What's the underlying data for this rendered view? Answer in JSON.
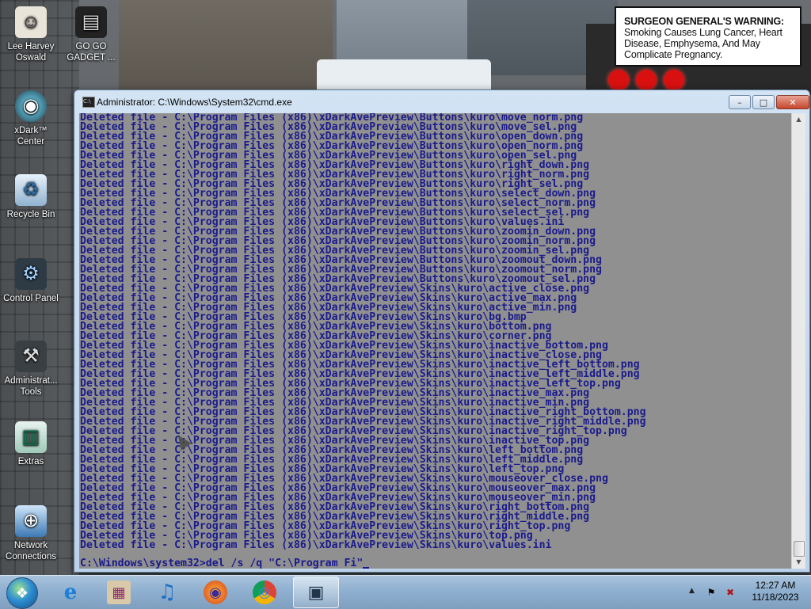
{
  "desktop": {
    "warning": {
      "heading": "SURGEON GENERAL'S WARNING:",
      "text": "Smoking Causes Lung Cancer, Heart Disease, Emphysema, And May Complicate Pregnancy."
    },
    "icons": [
      {
        "label": "Lee Harvey Oswald",
        "icon": "person-icon"
      },
      {
        "label": "GO GO GADGET ...",
        "icon": "gadget-icon"
      },
      {
        "label": "xDark™ Center",
        "icon": "xdark-center-icon"
      },
      {
        "label": "Recycle Bin",
        "icon": "recycle-bin-icon"
      },
      {
        "label": "Control Panel",
        "icon": "control-panel-icon"
      },
      {
        "label": "Administrat... Tools",
        "icon": "admin-tools-icon"
      },
      {
        "label": "Extras",
        "icon": "extras-icon"
      },
      {
        "label": "Network Connections",
        "icon": "network-icon"
      }
    ]
  },
  "cmd": {
    "title": "Administrator: C:\\Windows\\System32\\cmd.exe",
    "buttons": {
      "minimize": "–",
      "maximize": "□",
      "close": "✕"
    },
    "lines": [
      "Deleted file - C:\\Program Files (x86)\\xDarkAvePreview\\Buttons\\kuro\\move_norm.png",
      "Deleted file - C:\\Program Files (x86)\\xDarkAvePreview\\Buttons\\kuro\\move_sel.png",
      "Deleted file - C:\\Program Files (x86)\\xDarkAvePreview\\Buttons\\kuro\\open_down.png",
      "Deleted file - C:\\Program Files (x86)\\xDarkAvePreview\\Buttons\\kuro\\open_norm.png",
      "Deleted file - C:\\Program Files (x86)\\xDarkAvePreview\\Buttons\\kuro\\open_sel.png",
      "Deleted file - C:\\Program Files (x86)\\xDarkAvePreview\\Buttons\\kuro\\right_down.png",
      "Deleted file - C:\\Program Files (x86)\\xDarkAvePreview\\Buttons\\kuro\\right_norm.png",
      "Deleted file - C:\\Program Files (x86)\\xDarkAvePreview\\Buttons\\kuro\\right_sel.png",
      "Deleted file - C:\\Program Files (x86)\\xDarkAvePreview\\Buttons\\kuro\\select_down.png",
      "Deleted file - C:\\Program Files (x86)\\xDarkAvePreview\\Buttons\\kuro\\select_norm.png",
      "Deleted file - C:\\Program Files (x86)\\xDarkAvePreview\\Buttons\\kuro\\select_sel.png",
      "Deleted file - C:\\Program Files (x86)\\xDarkAvePreview\\Buttons\\kuro\\values.ini",
      "Deleted file - C:\\Program Files (x86)\\xDarkAvePreview\\Buttons\\kuro\\zoomin_down.png",
      "Deleted file - C:\\Program Files (x86)\\xDarkAvePreview\\Buttons\\kuro\\zoomin_norm.png",
      "Deleted file - C:\\Program Files (x86)\\xDarkAvePreview\\Buttons\\kuro\\zoomin_sel.png",
      "Deleted file - C:\\Program Files (x86)\\xDarkAvePreview\\Buttons\\kuro\\zoomout_down.png",
      "Deleted file - C:\\Program Files (x86)\\xDarkAvePreview\\Buttons\\kuro\\zoomout_norm.png",
      "Deleted file - C:\\Program Files (x86)\\xDarkAvePreview\\Buttons\\kuro\\zoomout_sel.png",
      "Deleted file - C:\\Program Files (x86)\\xDarkAvePreview\\Skins\\kuro\\active_close.png",
      "Deleted file - C:\\Program Files (x86)\\xDarkAvePreview\\Skins\\kuro\\active_max.png",
      "Deleted file - C:\\Program Files (x86)\\xDarkAvePreview\\Skins\\kuro\\active_min.png",
      "Deleted file - C:\\Program Files (x86)\\xDarkAvePreview\\Skins\\kuro\\bg.bmp",
      "Deleted file - C:\\Program Files (x86)\\xDarkAvePreview\\Skins\\kuro\\bottom.png",
      "Deleted file - C:\\Program Files (x86)\\xDarkAvePreview\\Skins\\kuro\\corner.png",
      "Deleted file - C:\\Program Files (x86)\\xDarkAvePreview\\Skins\\kuro\\inactive_bottom.png",
      "Deleted file - C:\\Program Files (x86)\\xDarkAvePreview\\Skins\\kuro\\inactive_close.png",
      "Deleted file - C:\\Program Files (x86)\\xDarkAvePreview\\Skins\\kuro\\inactive_left_bottom.png",
      "Deleted file - C:\\Program Files (x86)\\xDarkAvePreview\\Skins\\kuro\\inactive_left_middle.png",
      "Deleted file - C:\\Program Files (x86)\\xDarkAvePreview\\Skins\\kuro\\inactive_left_top.png",
      "Deleted file - C:\\Program Files (x86)\\xDarkAvePreview\\Skins\\kuro\\inactive_max.png",
      "Deleted file - C:\\Program Files (x86)\\xDarkAvePreview\\Skins\\kuro\\inactive_min.png",
      "Deleted file - C:\\Program Files (x86)\\xDarkAvePreview\\Skins\\kuro\\inactive_right_bottom.png",
      "Deleted file - C:\\Program Files (x86)\\xDarkAvePreview\\Skins\\kuro\\inactive_right_middle.png",
      "Deleted file - C:\\Program Files (x86)\\xDarkAvePreview\\Skins\\kuro\\inactive_right_top.png",
      "Deleted file - C:\\Program Files (x86)\\xDarkAvePreview\\Skins\\kuro\\inactive_top.png",
      "Deleted file - C:\\Program Files (x86)\\xDarkAvePreview\\Skins\\kuro\\left_bottom.png",
      "Deleted file - C:\\Program Files (x86)\\xDarkAvePreview\\Skins\\kuro\\left_middle.png",
      "Deleted file - C:\\Program Files (x86)\\xDarkAvePreview\\Skins\\kuro\\left_top.png",
      "Deleted file - C:\\Program Files (x86)\\xDarkAvePreview\\Skins\\kuro\\mouseover_close.png",
      "Deleted file - C:\\Program Files (x86)\\xDarkAvePreview\\Skins\\kuro\\mouseover_max.png",
      "Deleted file - C:\\Program Files (x86)\\xDarkAvePreview\\Skins\\kuro\\mouseover_min.png",
      "Deleted file - C:\\Program Files (x86)\\xDarkAvePreview\\Skins\\kuro\\right_bottom.png",
      "Deleted file - C:\\Program Files (x86)\\xDarkAvePreview\\Skins\\kuro\\right_middle.png",
      "Deleted file - C:\\Program Files (x86)\\xDarkAvePreview\\Skins\\kuro\\right_top.png",
      "Deleted file - C:\\Program Files (x86)\\xDarkAvePreview\\Skins\\kuro\\top.png",
      "Deleted file - C:\\Program Files (x86)\\xDarkAvePreview\\Skins\\kuro\\values.ini"
    ],
    "prompt": "C:\\Windows\\system32>del /s /q \"C:\\Program Fi\"",
    "colors": {
      "console_bg": "#909090",
      "console_text": "#1a1a8c"
    }
  },
  "taskbar": {
    "start": "start-orb-icon",
    "items": [
      {
        "name": "internet-explorer-icon",
        "glyph": "e",
        "active": false
      },
      {
        "name": "winrar-icon",
        "glyph": "▦",
        "active": false
      },
      {
        "name": "itunes-icon",
        "glyph": "♫",
        "active": false
      },
      {
        "name": "firefox-icon",
        "glyph": "◉",
        "active": false
      },
      {
        "name": "chrome-icon",
        "glyph": "◎",
        "active": false
      },
      {
        "name": "cmd-icon",
        "glyph": "▣",
        "active": true
      }
    ],
    "clock": {
      "time": "12:27 AM",
      "date": "11/18/2023"
    }
  }
}
